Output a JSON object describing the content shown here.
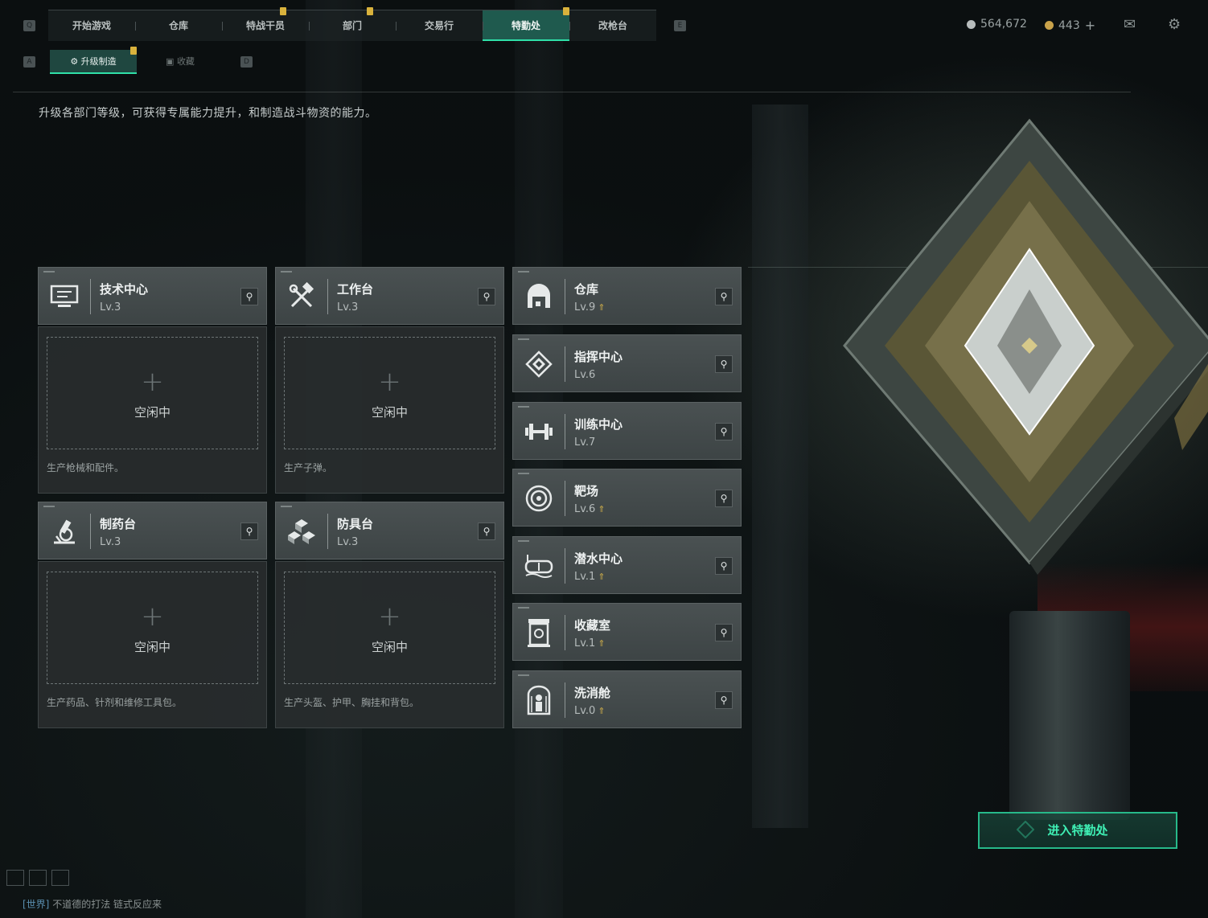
{
  "nav": {
    "tabs": [
      {
        "label": "开始游戏",
        "active": false,
        "flag": false
      },
      {
        "label": "仓库",
        "active": false,
        "flag": false
      },
      {
        "label": "特战干员",
        "active": false,
        "flag": true
      },
      {
        "label": "部门",
        "active": false,
        "flag": true
      },
      {
        "label": "交易行",
        "active": false,
        "flag": false
      },
      {
        "label": "特勤处",
        "active": true,
        "flag": true
      },
      {
        "label": "改枪台",
        "active": false,
        "flag": false
      }
    ],
    "key_left": "Q",
    "key_right": "E"
  },
  "currency": {
    "silver": "564,672",
    "gold": "443",
    "add": "+",
    "silver_color": "#b7bcbc",
    "gold_color": "#c9a24a"
  },
  "icons": {
    "mail": "mail-icon",
    "settings": "gear-icon"
  },
  "subtabs": {
    "items": [
      {
        "label": "升级制造",
        "active": true,
        "flag": true
      },
      {
        "label": "收藏",
        "active": false,
        "flag": false
      }
    ],
    "key_left": "A",
    "key_right": "D"
  },
  "description": "升级各部门等级，可获得专属能力提升，和制造战斗物资的能力。",
  "crafting": [
    {
      "name": "技术中心",
      "level": "Lv.3",
      "icon": "computer-icon",
      "idle": "空闲中",
      "desc": "生产枪械和配件。"
    },
    {
      "name": "工作台",
      "level": "Lv.3",
      "icon": "hammer-wrench-icon",
      "idle": "空闲中",
      "desc": "生产子弹。"
    },
    {
      "name": "制药台",
      "level": "Lv.3",
      "icon": "microscope-icon",
      "idle": "空闲中",
      "desc": "生产药品、针剂和维修工具包。"
    },
    {
      "name": "防具台",
      "level": "Lv.3",
      "icon": "cubes-icon",
      "idle": "空闲中",
      "desc": "生产头盔、护甲、胸挂和背包。"
    }
  ],
  "facilities": [
    {
      "name": "仓库",
      "level": "Lv.9",
      "icon": "warehouse-icon",
      "upgradable": true
    },
    {
      "name": "指挥中心",
      "level": "Lv.6",
      "icon": "command-chip-icon",
      "upgradable": false
    },
    {
      "name": "训练中心",
      "level": "Lv.7",
      "icon": "dumbbell-icon",
      "upgradable": false
    },
    {
      "name": "靶场",
      "level": "Lv.6",
      "icon": "target-icon",
      "upgradable": true
    },
    {
      "name": "潜水中心",
      "level": "Lv.1",
      "icon": "diving-mask-icon",
      "upgradable": true
    },
    {
      "name": "收藏室",
      "level": "Lv.1",
      "icon": "display-case-icon",
      "upgradable": true
    },
    {
      "name": "洗消舱",
      "level": "Lv.0",
      "icon": "decontamination-icon",
      "upgradable": true
    }
  ],
  "enter_button": "进入特勤处",
  "chat": {
    "channel": "[世界]",
    "message": "不道德的打法  链式反应来"
  }
}
